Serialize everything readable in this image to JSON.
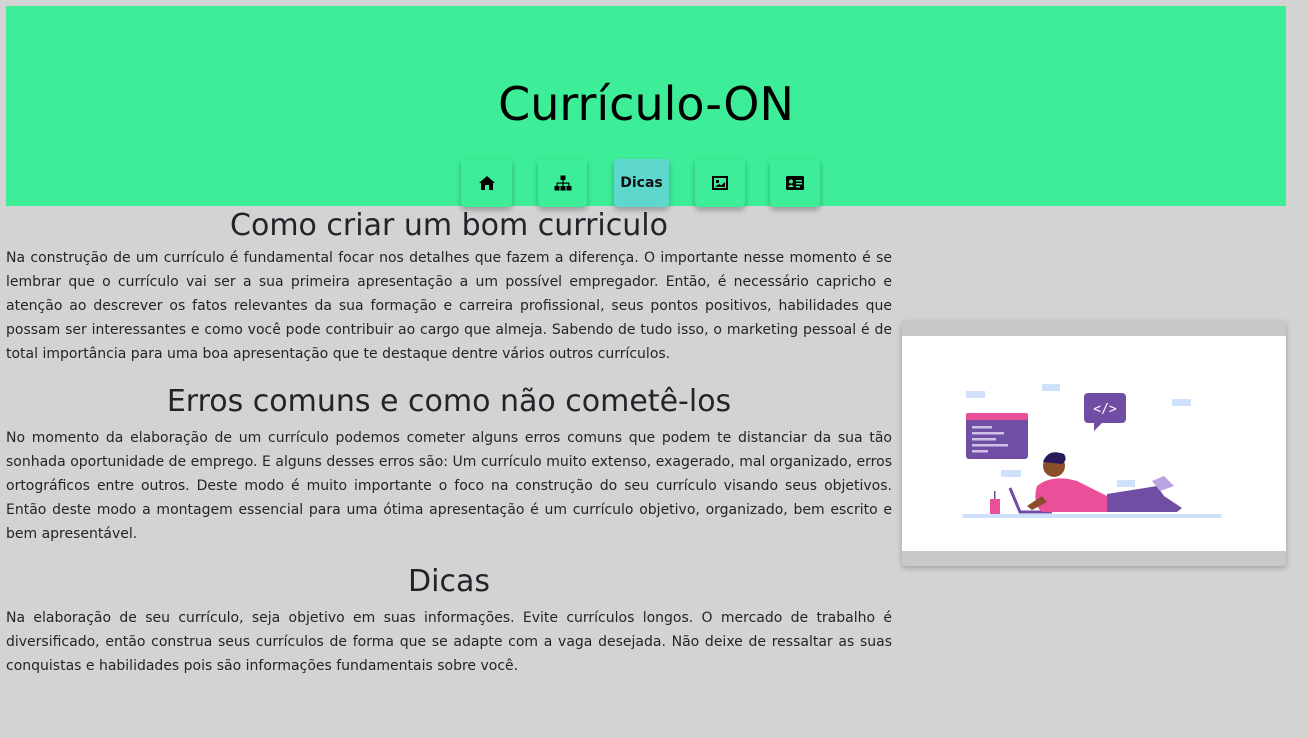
{
  "header": {
    "title": "Currículo-ON",
    "background": "#3ded97"
  },
  "nav": {
    "items": [
      {
        "icon": "home-icon",
        "label": ""
      },
      {
        "icon": "sitemap-icon",
        "label": ""
      },
      {
        "icon": "",
        "label": "Dicas",
        "active": true
      },
      {
        "icon": "image-icon",
        "label": ""
      },
      {
        "icon": "id-card-icon",
        "label": ""
      }
    ],
    "active_color": "#5ed8cc"
  },
  "sections": [
    {
      "title": "Como criar um bom curriculo",
      "text": "Na construção de um currículo é fundamental focar nos detalhes que fazem a diferença. O importante nesse momento é se lembrar que o currículo vai ser a sua primeira apresentação a um possível empregador. Então, é necessário capricho e atenção ao descrever os fatos relevantes da sua formação e carreira profissional, seus pontos positivos, habilidades que possam ser interessantes e como você pode contribuir ao cargo que almeja. Sabendo de tudo isso, o marketing pessoal é de total importância para uma boa apresentação que te destaque dentre vários outros currículos."
    },
    {
      "title": "Erros comuns e como não cometê-los",
      "text": "No momento da elaboração de um currículo podemos cometer alguns erros comuns que podem te distanciar da sua tão sonhada oportunidade de emprego. E alguns desses erros são: Um currículo muito extenso, exagerado, mal organizado, erros ortográficos entre outros. Deste modo é muito importante o foco na construção do seu currículo visando seus objetivos. Então deste modo a montagem essencial para uma ótima apresentação é um currículo objetivo, organizado, bem escrito e bem apresentável."
    },
    {
      "title": "Dicas",
      "text": "Na elaboração de seu currículo, seja objetivo em suas informações. Evite currículos longos. O mercado de trabalho é diversificado, então construa seus currículos de forma que se adapte com a vaga desejada. Não deixe de ressaltar as suas conquistas e habilidades pois são informações fundamentais sobre você."
    }
  ],
  "illustration": {
    "description_icon": "person-coding-illustration",
    "code_symbol": "</>"
  },
  "colors": {
    "page_background": "#d3d3d3",
    "accent_purple": "#6f4ea3",
    "accent_pink": "#ec4f9a"
  }
}
